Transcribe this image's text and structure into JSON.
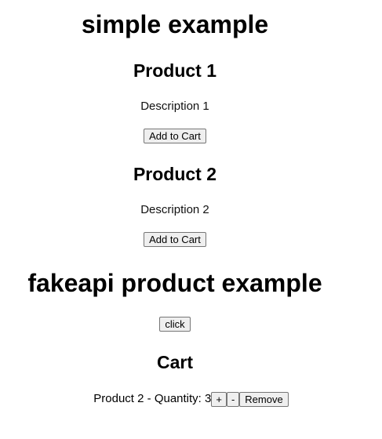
{
  "simple": {
    "title": "simple example",
    "products": [
      {
        "name": "Product 1",
        "description": "Description 1",
        "button": "Add to Cart"
      },
      {
        "name": "Product 2",
        "description": "Description 2",
        "button": "Add to Cart"
      }
    ]
  },
  "fakeapi": {
    "title": "fakeapi product example",
    "button": "click"
  },
  "cart": {
    "title": "Cart",
    "items": [
      {
        "label": "Product 2 - Quantity: 3",
        "plus": "+",
        "minus": "-",
        "remove": "Remove"
      }
    ]
  }
}
